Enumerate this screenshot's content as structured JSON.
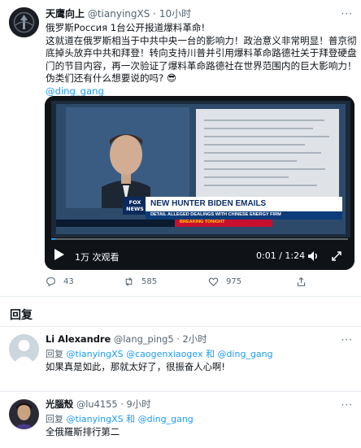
{
  "tweet": {
    "display_name": "天鹰向上",
    "handle": "@tianyingXS",
    "separator": "·",
    "time": "10小时",
    "more": "···",
    "lines": [
      "俄罗斯Россия 1台公开报道爆料革命!",
      "这就道在俄罗斯相当于中共中央一台的影响力！政治意义非常明显！普京彻",
      "底掉头放弃中共和拜登！转向支持川普并引用爆料革命路德社关于拜登硬盘",
      "门的节目内容，再一次验证了爆料革命路德社在世界范围内的巨大影响力！",
      "伪类们还有什么想要说的吗? 😎"
    ],
    "mention": "@ding_gang",
    "video": {
      "views": "1万 次观看",
      "time": "0:01 / 1:24",
      "progress": 0.013,
      "banner_title": "NEW HUNTER BIDEN EMAILS",
      "banner_sub": "DETAIL ALLEGED DEALINGS WITH CHINESE ENERGY FIRM",
      "breaking": "BREAKING TONIGHT",
      "network": "FOX NEWS"
    },
    "actions": {
      "replies": "43",
      "retweets": "585",
      "likes": "975"
    }
  },
  "replies_heading": "回复",
  "replies": [
    {
      "display_name": "Li Alexandre",
      "handle": "@lang_ping5",
      "separator": "·",
      "time": "2小时",
      "replying_prefix": "回复 ",
      "replying_to": "@tianyingXS @caogenxiaogex 和 @ding_gang",
      "text": "如果真是如此，那就太好了，很振奋人心啊!"
    },
    {
      "display_name": "光腦殼",
      "handle": "@lu4155",
      "separator": "·",
      "time": "9小时",
      "replying_prefix": "回复 ",
      "replying_to": "@tianyingXS 和 @ding_gang",
      "text": "全俄羅斯排行第二"
    }
  ],
  "colors": {
    "accent": "#1d9bf0",
    "secondary_text": "#536471",
    "divider": "#e6ecf0"
  },
  "icons": {
    "reply": "speech-bubble-icon",
    "retweet": "retweet-arrows-icon",
    "like": "heart-icon",
    "share": "share-upload-icon",
    "play": "play-icon",
    "volume": "volume-icon",
    "fullscreen": "expand-icon"
  }
}
